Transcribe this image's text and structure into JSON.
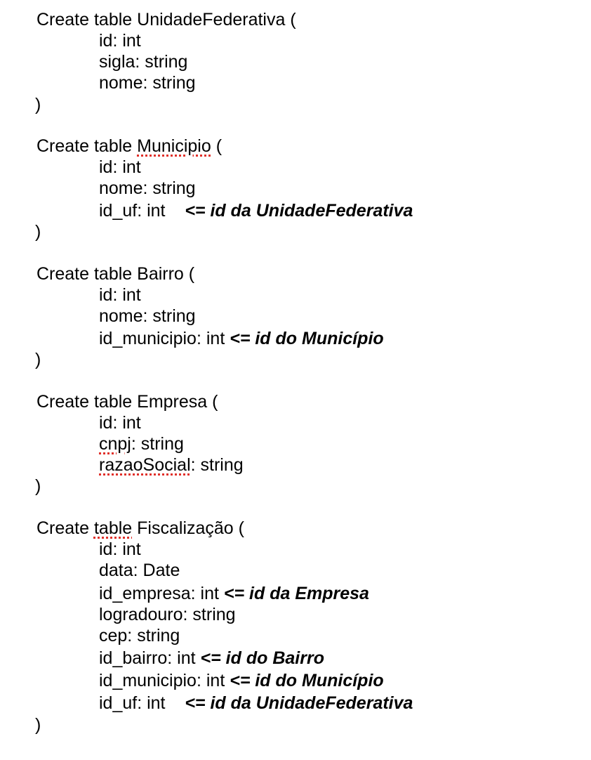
{
  "tables": [
    {
      "header_pre": "Create table ",
      "name": "UnidadeFederativa",
      "header_post": " (",
      "fields": [
        {
          "label": "id: int"
        },
        {
          "label": "sigla: string"
        },
        {
          "label": "nome: string"
        }
      ],
      "close": ")"
    },
    {
      "header_pre": "Create table ",
      "name": "Municipio",
      "header_post": " (",
      "fields": [
        {
          "label": "id: int"
        },
        {
          "label": "nome: string"
        },
        {
          "label": "id_uf: int",
          "ref": "<= id da UnidadeFederativa"
        }
      ],
      "close": ")"
    },
    {
      "header_pre": "Create table ",
      "name": "Bairro",
      "header_post": " (",
      "fields": [
        {
          "label": "id: int"
        },
        {
          "label": "nome: string"
        },
        {
          "label": "id_municipio: int",
          "ref": "<= id do Município"
        }
      ],
      "close": ")"
    },
    {
      "header_pre": "Create table ",
      "name": "Empresa",
      "header_post": " (",
      "fields": [
        {
          "label": "id: int"
        },
        {
          "label_a": "cnpj",
          "label_b": ": string"
        },
        {
          "label_a": "razaoSocial",
          "label_b": ": string"
        }
      ],
      "close": ")"
    },
    {
      "header_pre": "Create ",
      "header_word": "table",
      "name": "Fiscalização",
      "header_post": " (",
      "fields": [
        {
          "label": "id: int"
        },
        {
          "label": "data: Date"
        },
        {
          "label": "id_empresa: int",
          "ref": "<= id da Empresa"
        },
        {
          "label": "logradouro: string"
        },
        {
          "label": "cep: string"
        },
        {
          "label": "id_bairro: int",
          "ref": "<= id do Bairro"
        },
        {
          "label": "id_municipio: int",
          "ref": "<= id do Município"
        },
        {
          "label": "id_uf: int",
          "ref": "<= id da UnidadeFederativa"
        }
      ],
      "close": ")"
    }
  ],
  "spellcheck_color": "#e0302a"
}
